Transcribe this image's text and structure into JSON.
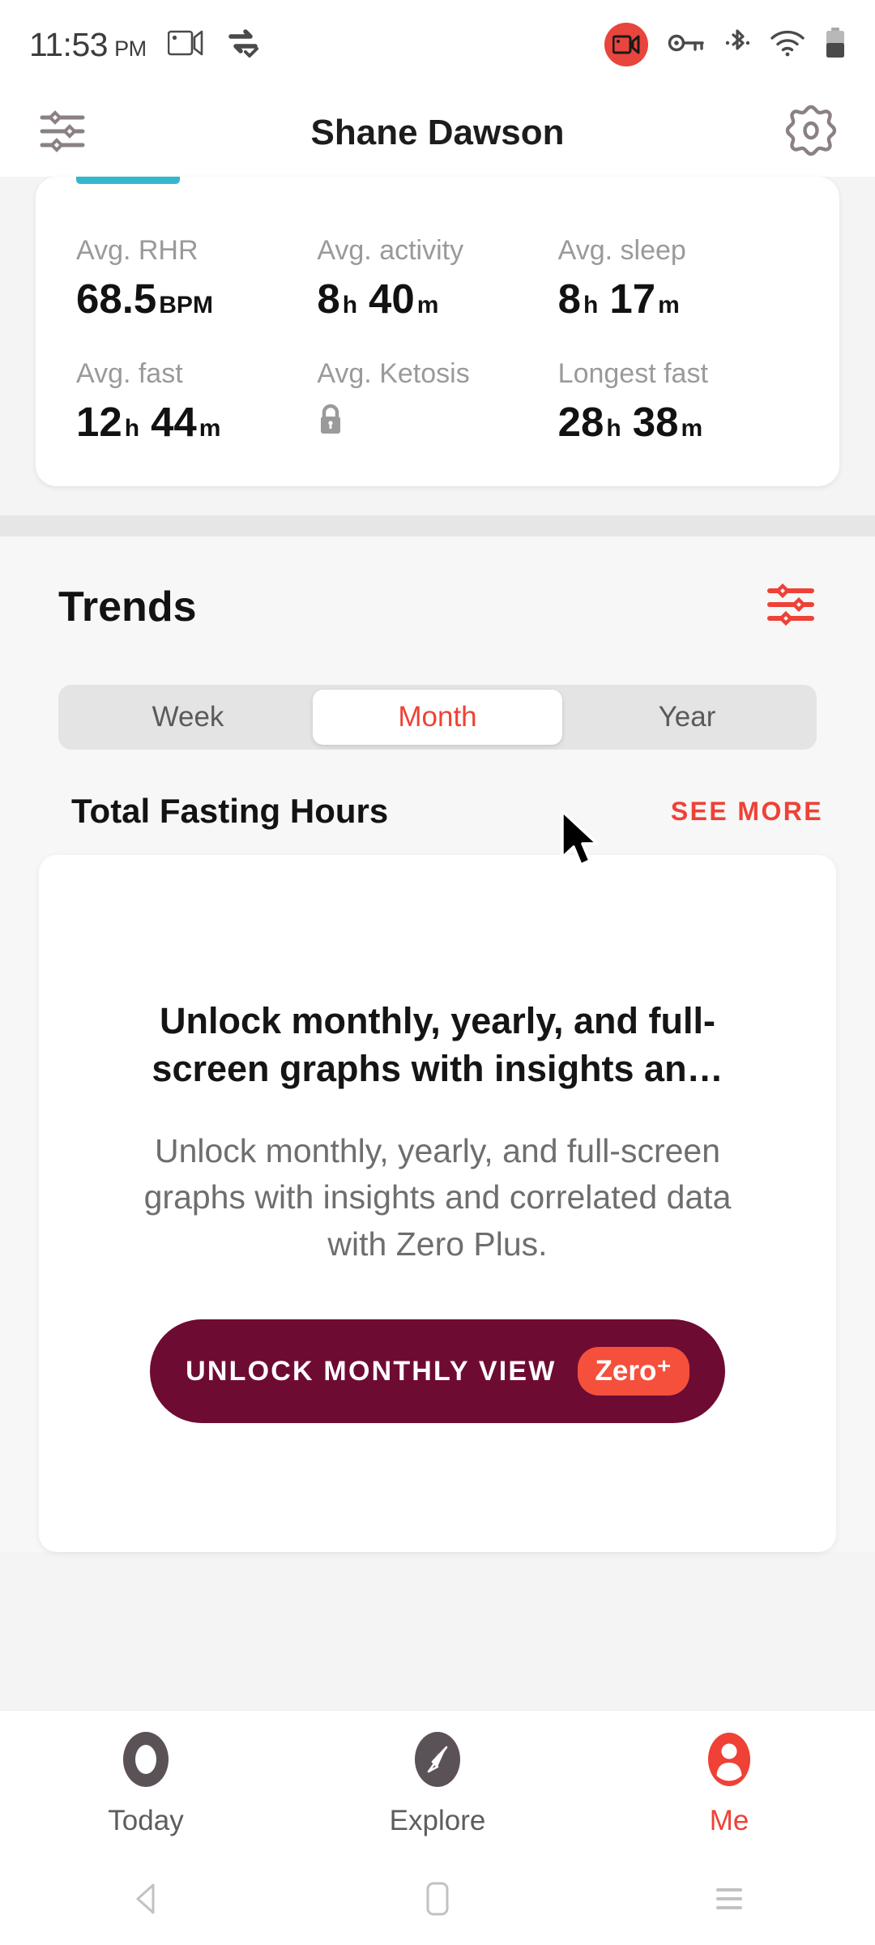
{
  "status_bar": {
    "time": "11:53",
    "ampm": "PM",
    "icons": [
      "screencast-icon",
      "vpn-sync-icon",
      "screen-record-icon",
      "vpn-key-icon",
      "bluetooth-icon",
      "wifi-icon",
      "battery-icon"
    ]
  },
  "header": {
    "title": "Shane Dawson",
    "left_icon": "sliders-icon",
    "right_icon": "gear-icon"
  },
  "stats": {
    "items": [
      {
        "label": "Avg. RHR",
        "value": "68.5",
        "unit": "BPM",
        "locked": false
      },
      {
        "label": "Avg. activity",
        "value": "8",
        "unit": "h",
        "value2": "40",
        "unit2": "m",
        "locked": false
      },
      {
        "label": "Avg. sleep",
        "value": "8",
        "unit": "h",
        "value2": "17",
        "unit2": "m",
        "locked": false
      },
      {
        "label": "Avg. fast",
        "value": "12",
        "unit": "h",
        "value2": "44",
        "unit2": "m",
        "locked": false
      },
      {
        "label": "Avg. Ketosis",
        "value": "",
        "unit": "",
        "locked": true
      },
      {
        "label": "Longest fast",
        "value": "28",
        "unit": "h",
        "value2": "38",
        "unit2": "m",
        "locked": false
      }
    ]
  },
  "trends": {
    "title": "Trends",
    "filter_icon": "sliders-icon",
    "ranges": [
      {
        "label": "Week",
        "selected": false
      },
      {
        "label": "Month",
        "selected": true
      },
      {
        "label": "Year",
        "selected": false
      }
    ],
    "chart_section_title": "Total Fasting Hours",
    "see_more": "SEE MORE"
  },
  "upsell": {
    "headline": "Unlock monthly, yearly, and full-screen graphs with insights an…",
    "body": "Unlock monthly, yearly, and full-screen graphs with insights and correlated data with Zero Plus.",
    "cta_label": "UNLOCK MONTHLY VIEW",
    "cta_badge": "Zero⁺"
  },
  "bottom_nav": [
    {
      "label": "Today",
      "icon": "ring-icon",
      "active": false
    },
    {
      "label": "Explore",
      "icon": "compass-icon",
      "active": false
    },
    {
      "label": "Me",
      "icon": "person-icon",
      "active": true
    }
  ],
  "system_nav": [
    "back-icon",
    "home-icon",
    "recents-icon"
  ],
  "colors": {
    "accent": "#ef4136",
    "cta_bg": "#6e0b33",
    "badge": "#f4503c",
    "teal": "#35b6cc"
  }
}
